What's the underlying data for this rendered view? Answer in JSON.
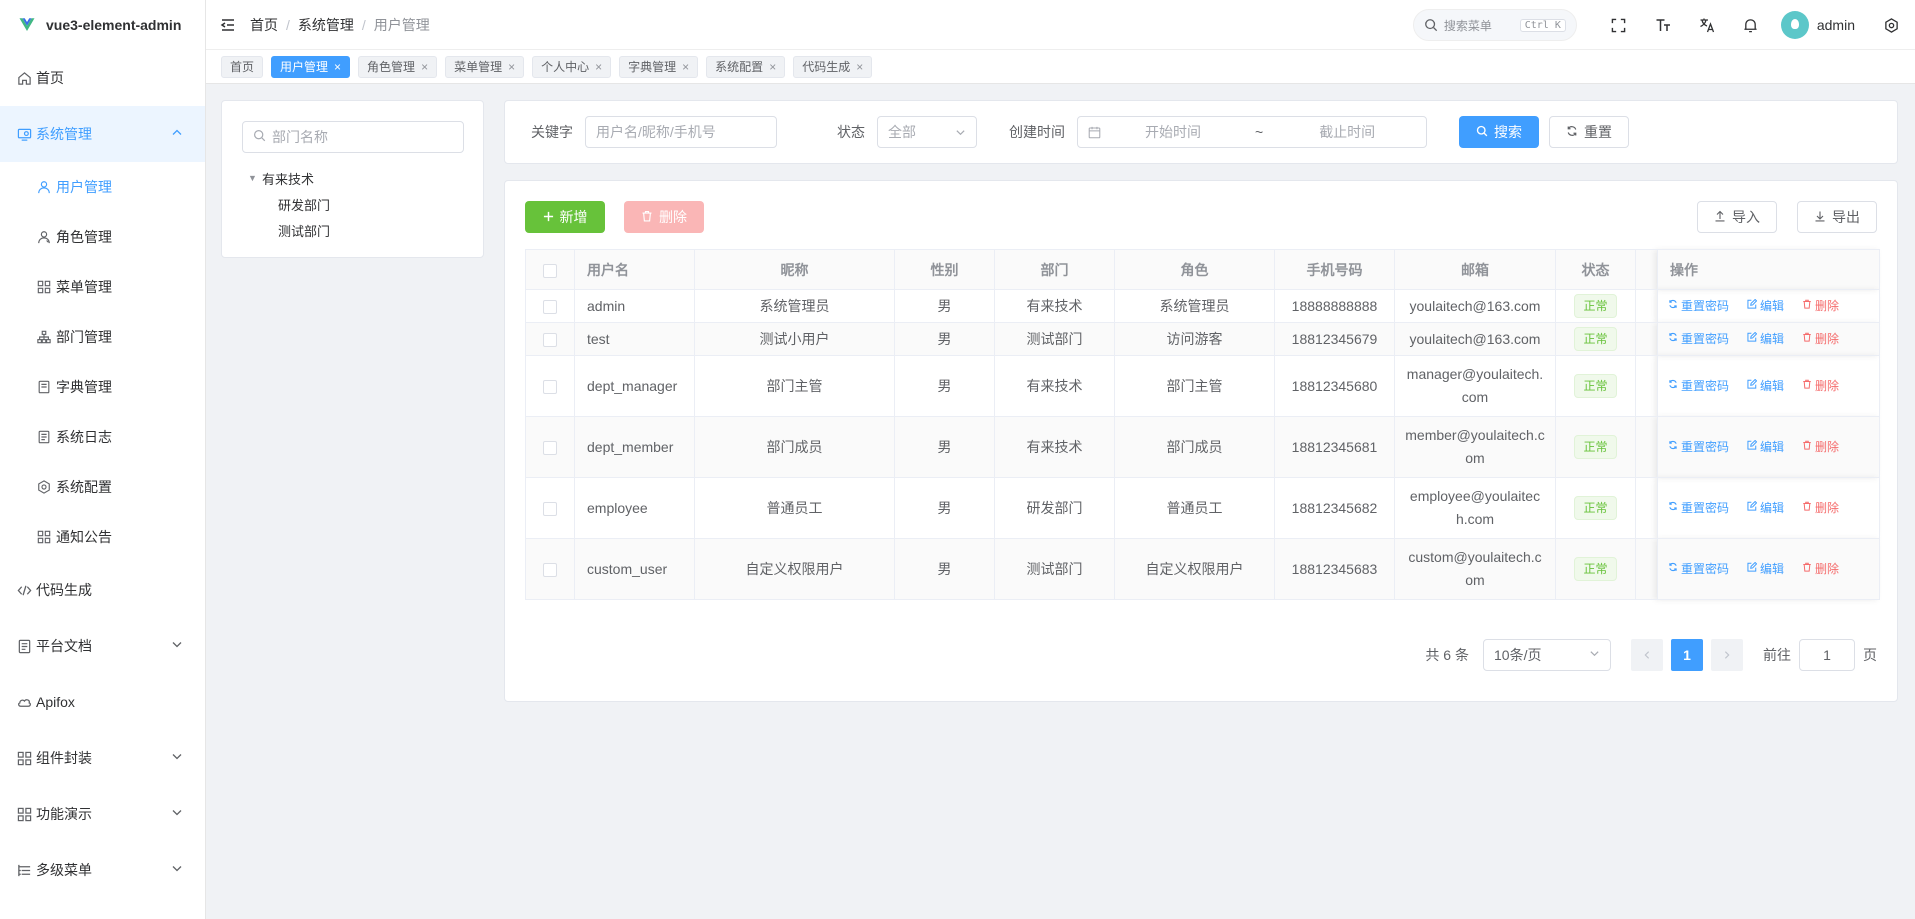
{
  "app": {
    "name": "vue3-element-admin"
  },
  "sidebar": {
    "home": "首页",
    "system": "系统管理",
    "system_items": [
      {
        "label": "用户管理",
        "icon": "user-icon"
      },
      {
        "label": "角色管理",
        "icon": "role-icon"
      },
      {
        "label": "菜单管理",
        "icon": "menu-icon"
      },
      {
        "label": "部门管理",
        "icon": "tree-icon"
      },
      {
        "label": "字典管理",
        "icon": "dict-icon"
      },
      {
        "label": "系统日志",
        "icon": "log-icon"
      },
      {
        "label": "系统配置",
        "icon": "setting-icon"
      },
      {
        "label": "通知公告",
        "icon": "notice-icon"
      }
    ],
    "codegen": "代码生成",
    "docs": "平台文档",
    "apifox": "Apifox",
    "components": "组件封装",
    "demo": "功能演示",
    "multilevel": "多级菜单"
  },
  "header": {
    "breadcrumb": [
      "首页",
      "系统管理",
      "用户管理"
    ],
    "search_placeholder": "搜索菜单",
    "search_shortcut": "Ctrl K",
    "username": "admin"
  },
  "tags": [
    "首页",
    "用户管理",
    "角色管理",
    "菜单管理",
    "个人中心",
    "字典管理",
    "系统配置",
    "代码生成"
  ],
  "dept": {
    "placeholder": "部门名称",
    "root": "有来技术",
    "children": [
      "研发部门",
      "测试部门"
    ]
  },
  "filter": {
    "keyword_label": "关键字",
    "keyword_placeholder": "用户名/昵称/手机号",
    "status_label": "状态",
    "status_value": "全部",
    "time_label": "创建时间",
    "start_placeholder": "开始时间",
    "range_sep": "~",
    "end_placeholder": "截止时间",
    "search_btn": "搜索",
    "reset_btn": "重置"
  },
  "toolbar": {
    "add": "新增",
    "delete": "删除",
    "import": "导入",
    "export": "导出"
  },
  "table": {
    "headers": [
      "用户名",
      "昵称",
      "性别",
      "部门",
      "角色",
      "手机号码",
      "邮箱",
      "状态",
      "操作"
    ],
    "rows": [
      {
        "username": "admin",
        "nickname": "系统管理员",
        "gender": "男",
        "dept": "有来技术",
        "role": "系统管理员",
        "mobile": "18888888888",
        "email": "youlaitech@163.com",
        "status": "正常"
      },
      {
        "username": "test",
        "nickname": "测试小用户",
        "gender": "男",
        "dept": "测试部门",
        "role": "访问游客",
        "mobile": "18812345679",
        "email": "youlaitech@163.com",
        "status": "正常"
      },
      {
        "username": "dept_manager",
        "nickname": "部门主管",
        "gender": "男",
        "dept": "有来技术",
        "role": "部门主管",
        "mobile": "18812345680",
        "email": "manager@youlaitech.com",
        "status": "正常"
      },
      {
        "username": "dept_member",
        "nickname": "部门成员",
        "gender": "男",
        "dept": "有来技术",
        "role": "部门成员",
        "mobile": "18812345681",
        "email": "member@youlaitech.com",
        "status": "正常"
      },
      {
        "username": "employee",
        "nickname": "普通员工",
        "gender": "男",
        "dept": "研发部门",
        "role": "普通员工",
        "mobile": "18812345682",
        "email": "employee@youlaitech.com",
        "status": "正常"
      },
      {
        "username": "custom_user",
        "nickname": "自定义权限用户",
        "gender": "男",
        "dept": "测试部门",
        "role": "自定义权限用户",
        "mobile": "18812345683",
        "email": "custom@youlaitech.com",
        "status": "正常"
      }
    ],
    "ops": {
      "reset_pwd": "重置密码",
      "edit": "编辑",
      "delete": "删除"
    }
  },
  "pagination": {
    "total": "共 6 条",
    "page_size": "10条/页",
    "current": "1",
    "goto_label": "前往",
    "goto_value": "1",
    "page_suffix": "页"
  },
  "colors": {
    "primary": "#409eff",
    "success": "#67c23a",
    "danger": "#f56c6c"
  }
}
